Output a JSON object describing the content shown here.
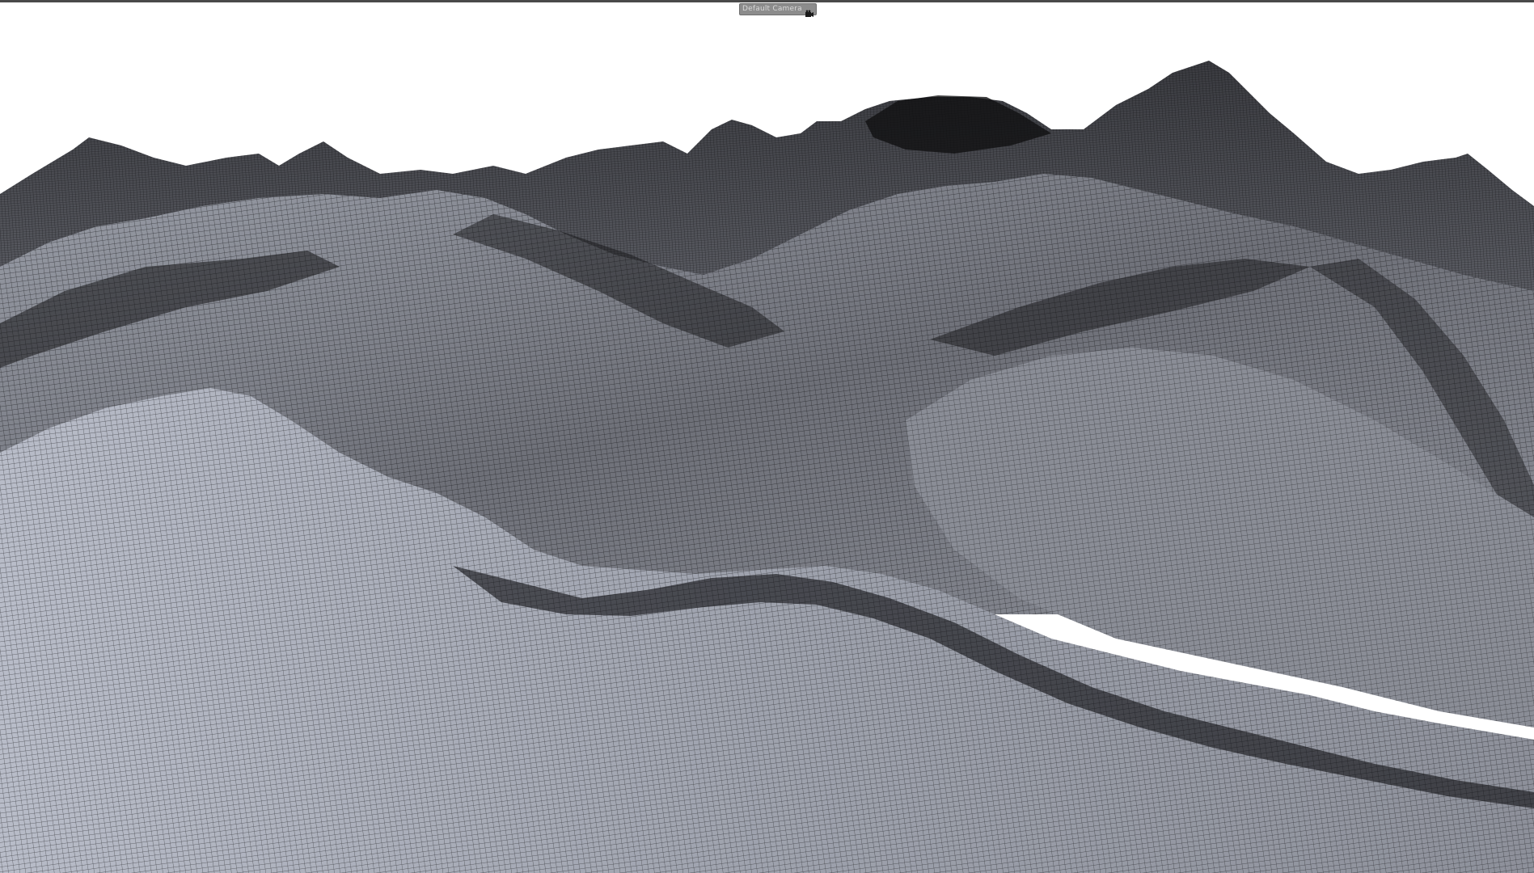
{
  "viewport": {
    "camera_label": "Default Camera",
    "camera_icon": "camera-icon"
  },
  "colors": {
    "background": "#ffffff",
    "mesh_dark": "#1e1e22",
    "mesh_mid": "#5e6068",
    "mesh_light": "#b4b8c4",
    "wire": "#0c0c0e"
  }
}
